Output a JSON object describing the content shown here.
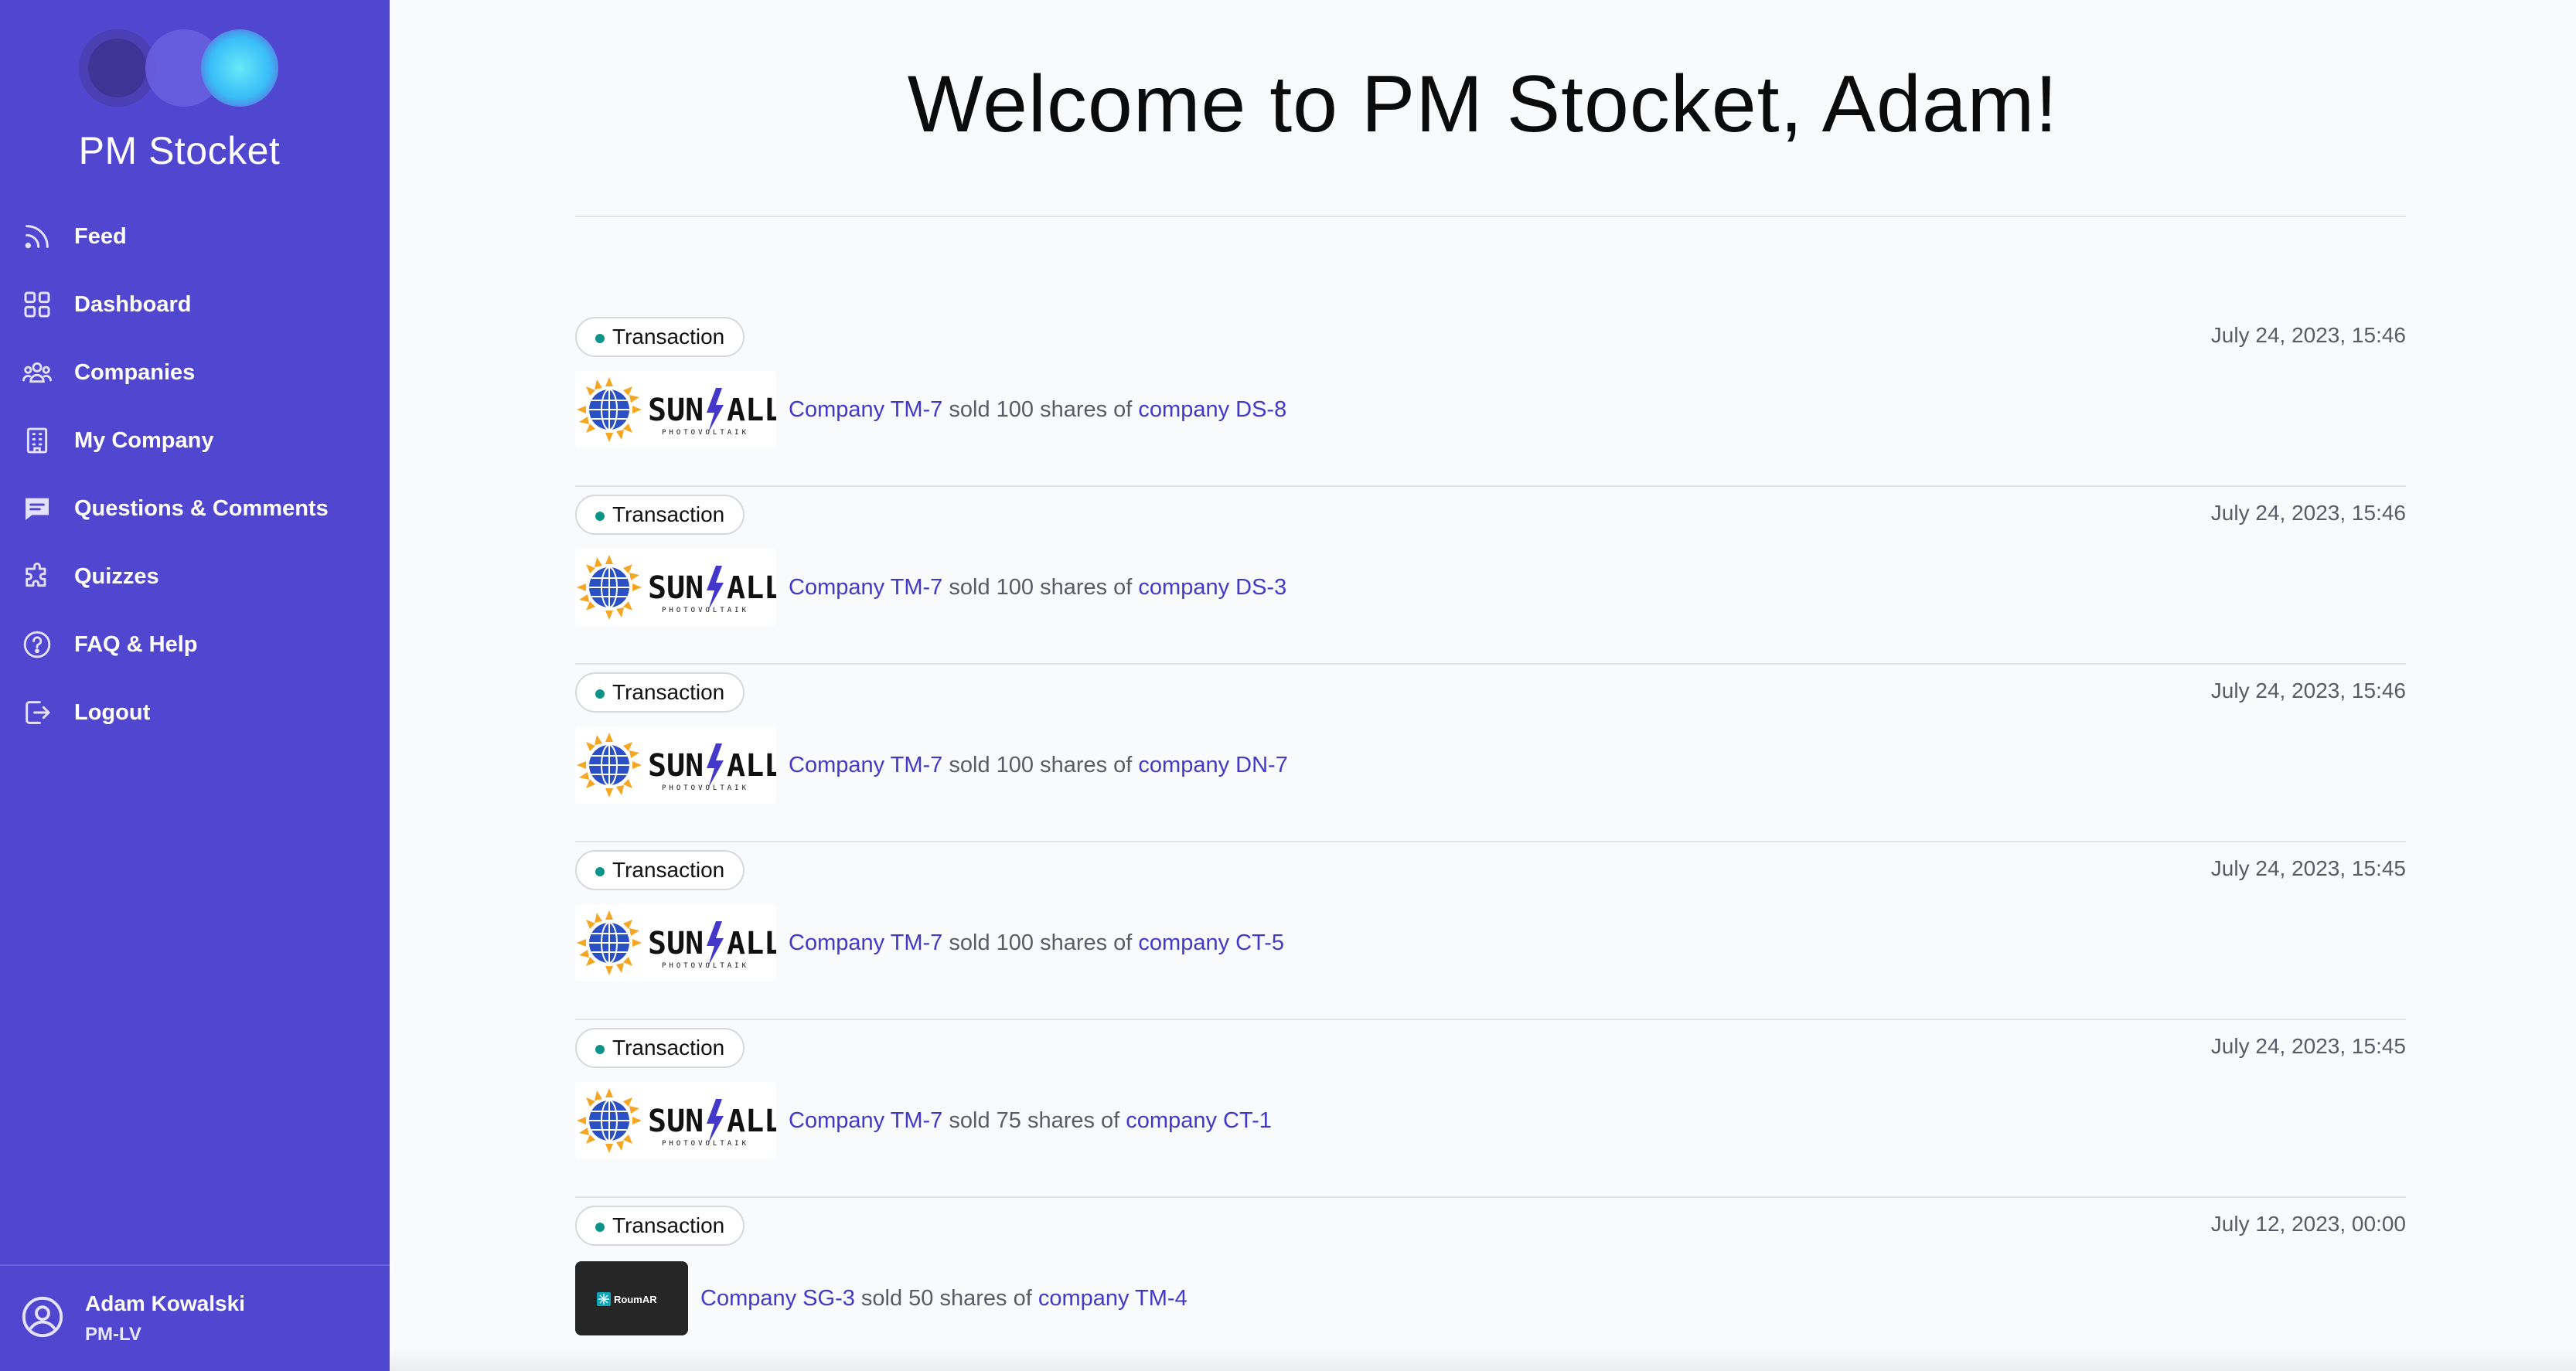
{
  "sidebar": {
    "brand": "PM Stocket",
    "items": [
      {
        "label": "Feed",
        "icon": "rss-icon"
      },
      {
        "label": "Dashboard",
        "icon": "grid-icon"
      },
      {
        "label": "Companies",
        "icon": "users-icon"
      },
      {
        "label": "My Company",
        "icon": "building-icon"
      },
      {
        "label": "Questions & Comments",
        "icon": "chat-icon"
      },
      {
        "label": "Quizzes",
        "icon": "puzzle-icon"
      },
      {
        "label": "FAQ & Help",
        "icon": "question-circle-icon"
      },
      {
        "label": "Logout",
        "icon": "logout-icon"
      }
    ],
    "user": {
      "name": "Adam Kowalski",
      "role": "PM-LV"
    }
  },
  "main": {
    "welcome": "Welcome to PM Stocket, Adam!",
    "feed": [
      {
        "badge": "Transaction",
        "date": "July 24, 2023, 15:46",
        "logo": "SUN ALL",
        "seller": "Company TM-7",
        "middle": " sold 100 shares of ",
        "target": "company DS-8"
      },
      {
        "badge": "Transaction",
        "date": "July 24, 2023, 15:46",
        "logo": "SUN ALL",
        "seller": "Company TM-7",
        "middle": " sold 100 shares of ",
        "target": "company DS-3"
      },
      {
        "badge": "Transaction",
        "date": "July 24, 2023, 15:46",
        "logo": "SUN ALL",
        "seller": "Company TM-7",
        "middle": " sold 100 shares of ",
        "target": "company DN-7"
      },
      {
        "badge": "Transaction",
        "date": "July 24, 2023, 15:45",
        "logo": "SUN ALL",
        "seller": "Company TM-7",
        "middle": " sold 100 shares of ",
        "target": "company CT-5"
      },
      {
        "badge": "Transaction",
        "date": "July 24, 2023, 15:45",
        "logo": "SUN ALL",
        "seller": "Company TM-7",
        "middle": " sold 75 shares of ",
        "target": "company CT-1"
      },
      {
        "badge": "Transaction",
        "date": "July 12, 2023, 00:00",
        "logo": "RoumAR",
        "seller": "Company SG-3",
        "middle": " sold 50 shares of ",
        "target": "company TM-4"
      }
    ]
  },
  "colors": {
    "sidebar_bg": "#5046cf",
    "link": "#4338ca",
    "badge_dot": "#0d9488",
    "page_bg": "#f9fafb"
  }
}
